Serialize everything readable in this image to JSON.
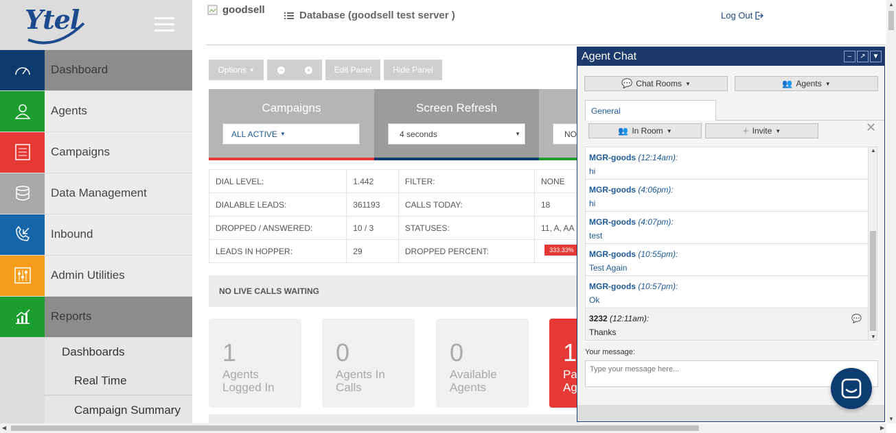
{
  "header": {
    "brand": "goodsell",
    "db_title": "Database (goodsell test server )",
    "logout": "Log Out"
  },
  "sidebar": {
    "logo": "Ytel",
    "items": [
      {
        "label": "Dashboard",
        "icon": "speedometer-icon",
        "color": "#0d3b6e",
        "active": true
      },
      {
        "label": "Agents",
        "icon": "user-icon",
        "color": "#1c9e2e",
        "active": false
      },
      {
        "label": "Campaigns",
        "icon": "list-icon",
        "color": "#e53935",
        "active": false
      },
      {
        "label": "Data Management",
        "icon": "database-icon",
        "color": "#a8a8a8",
        "active": false
      },
      {
        "label": "Inbound",
        "icon": "phone-incoming-icon",
        "color": "#1565a8",
        "active": false
      },
      {
        "label": "Admin Utilities",
        "icon": "sliders-icon",
        "color": "#f59c1a",
        "active": false
      },
      {
        "label": "Reports",
        "icon": "chart-icon",
        "color": "#1c9e2e",
        "active": true
      }
    ],
    "sub_items": [
      "Dashboards",
      "Real Time",
      "Campaign Summary"
    ]
  },
  "toolbar": {
    "options": "Options",
    "edit_panel": "Edit Panel",
    "hide_panel": "Hide Panel"
  },
  "panels": {
    "campaigns_title": "Campaigns",
    "campaigns_value": "ALL ACTIVE",
    "refresh_title": "Screen Refresh",
    "refresh_value": "4 seconds",
    "third_value": "NO"
  },
  "stats": [
    [
      "DIAL LEVEL:",
      "1.442",
      "FILTER:",
      "NONE"
    ],
    [
      "DIALABLE LEADS:",
      "361193",
      "CALLS TODAY:",
      "18"
    ],
    [
      "DROPPED / ANSWERED:",
      "10 / 3",
      "STATUSES:",
      "11, A, AA"
    ],
    [
      "LEADS IN HOPPER:",
      "29",
      "DROPPED PERCENT:",
      "333.33%"
    ]
  ],
  "no_live_calls": "NO LIVE CALLS WAITING",
  "cards": [
    {
      "num": "1",
      "label": "Agents Logged In"
    },
    {
      "num": "0",
      "label": "Agents In Calls"
    },
    {
      "num": "0",
      "label": "Available Agents"
    },
    {
      "num": "1",
      "label": "Pa Ag"
    }
  ],
  "chat": {
    "title": "Agent Chat",
    "chat_rooms": "Chat Rooms",
    "agents": "Agents",
    "tab": "General",
    "in_room": "In Room",
    "invite": "Invite",
    "messages": [
      {
        "who": "MGR-goods",
        "time": "(12:14am):",
        "text": "hi",
        "self": false
      },
      {
        "who": "MGR-goods",
        "time": "(4:06pm):",
        "text": "hi",
        "self": false
      },
      {
        "who": "MGR-goods",
        "time": "(4:07pm):",
        "text": "test",
        "self": false
      },
      {
        "who": "MGR-goods",
        "time": "(10:55pm):",
        "text": "Test Again",
        "self": false
      },
      {
        "who": "MGR-goods",
        "time": "(10:57pm):",
        "text": "Ok",
        "self": false
      },
      {
        "who": "3232",
        "time": "(12:11am):",
        "text": "Thanks",
        "self": true
      }
    ],
    "your_message_label": "Your message:",
    "placeholder": "Type your message here..."
  }
}
